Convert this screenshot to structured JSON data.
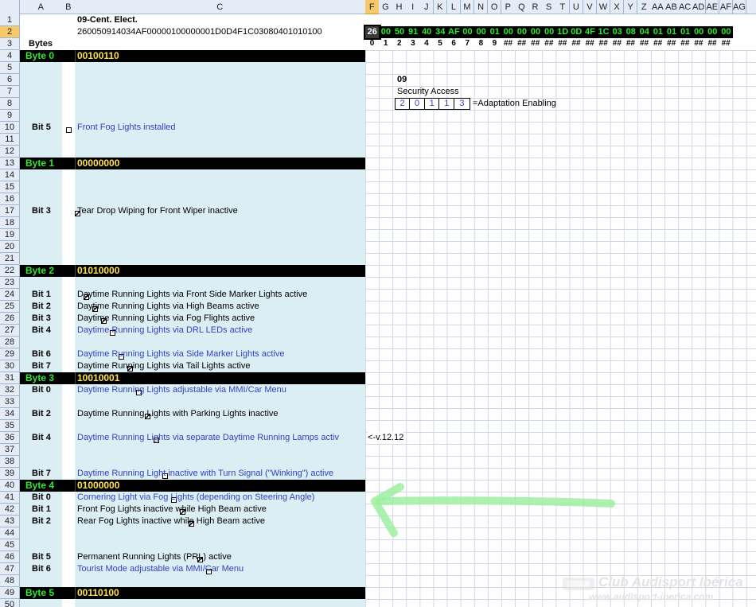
{
  "columns": [
    "A",
    "B",
    "C",
    "F",
    "G",
    "H",
    "I",
    "J",
    "K",
    "L",
    "M",
    "N",
    "O",
    "P",
    "Q",
    "R",
    "S",
    "T",
    "U",
    "V",
    "W",
    "X",
    "Y",
    "Z",
    "AA",
    "AB",
    "AC",
    "AD",
    "AE",
    "AF",
    "AG"
  ],
  "rows": [
    "1",
    "2",
    "3",
    "4",
    "5",
    "6",
    "7",
    "8",
    "9",
    "10",
    "11",
    "12",
    "13",
    "14",
    "15",
    "16",
    "17",
    "18",
    "19",
    "20",
    "21",
    "22",
    "23",
    "24",
    "25",
    "26",
    "27",
    "28",
    "29",
    "30",
    "31",
    "32",
    "33",
    "34",
    "35",
    "36",
    "37",
    "38",
    "39",
    "40",
    "41",
    "42",
    "43",
    "44",
    "45",
    "46",
    "47",
    "48",
    "49",
    "50"
  ],
  "header": {
    "module": "09-Cent. Elect.",
    "coding": "260050914034AF00000100000001D0D4F1C03080401010100",
    "bytes_label": "Bytes"
  },
  "hex_values": [
    "26",
    "00",
    "50",
    "91",
    "40",
    "34",
    "AF",
    "00",
    "00",
    "01",
    "00",
    "00",
    "00",
    "00",
    "1D",
    "0D",
    "4F",
    "1C",
    "03",
    "08",
    "04",
    "01",
    "01",
    "01",
    "00",
    "00",
    "00"
  ],
  "index_values": [
    "0",
    "1",
    "2",
    "3",
    "4",
    "5",
    "6",
    "7",
    "8",
    "9",
    "##",
    "##",
    "##",
    "##",
    "##",
    "##",
    "##",
    "##",
    "##",
    "##",
    "##",
    "##",
    "##",
    "##",
    "##",
    "##",
    "##"
  ],
  "security": {
    "module": "09",
    "title": "Security Access",
    "digits": [
      "2",
      "0",
      "1",
      "1",
      "3"
    ],
    "note": "=Adaptation Enabling"
  },
  "version_note": "<-v.12.12",
  "bytes": [
    {
      "title": "Byte 0",
      "bits": "00100110"
    },
    {
      "title": "Byte 1",
      "bits": "00000000"
    },
    {
      "title": "Byte 2",
      "bits": "01010000"
    },
    {
      "title": "Byte 3",
      "bits": "10010001"
    },
    {
      "title": "Byte 4",
      "bits": "01000000"
    },
    {
      "title": "Byte 5",
      "bits": "00110100"
    }
  ],
  "entries": [
    {
      "bit": "Bit 5",
      "text": "Front Fog Lights installed",
      "checked": false
    },
    {
      "bit": "Bit 3",
      "text": "Tear Drop Wiping for Front Wiper inactive",
      "checked": true
    },
    {
      "bit": "Bit 1",
      "text": "Daytime Running Lights via Front Side Marker Lights active",
      "checked": true
    },
    {
      "bit": "Bit 2",
      "text": "Daytime Running Lights via High Beams active",
      "checked": true
    },
    {
      "bit": "Bit 3",
      "text": "Daytime Running Lights via Fog Flights active",
      "checked": true
    },
    {
      "bit": "Bit 4",
      "text": "Daytime Running Lights via DRL LEDs active",
      "checked": false
    },
    {
      "bit": "Bit 6",
      "text": "Daytime Running Lights via Side Marker Lights active",
      "checked": false
    },
    {
      "bit": "Bit 7",
      "text": "Daytime Running Lights via Tail Lights active",
      "checked": true
    },
    {
      "bit": "Bit 0",
      "text": "Daytime Running Lights adjustable via MMI/Car Menu",
      "checked": false
    },
    {
      "bit": "Bit 2",
      "text": "Daytime Running Lights with Parking Lights inactive",
      "checked": true
    },
    {
      "bit": "Bit 4",
      "text": "Daytime Running Lights via separate Daytime Running Lamps activ",
      "checked": false
    },
    {
      "bit": "Bit 7",
      "text": "Daytime Running Light inactive with Turn Signal (\"Winking\") active",
      "checked": false
    },
    {
      "bit": "Bit 0",
      "text": "Cornering Light via Fog Lights (depending on Steering Angle)",
      "checked": false
    },
    {
      "bit": "Bit 1",
      "text": "Front Fog Lights inactive while High Beam active",
      "checked": true
    },
    {
      "bit": "Bit 2",
      "text": "Rear Fog Lights inactive while High Beam active",
      "checked": true
    },
    {
      "bit": "Bit 5",
      "text": "Permanent Running Lights (PRL) active",
      "checked": true
    },
    {
      "bit": "Bit 6",
      "text": "Tourist Mode adjustable via MMI/Car Menu",
      "checked": false
    }
  ],
  "watermark": {
    "line1": "Club Audisport Ibérica",
    "line2": "www.audisport-iberica.com"
  },
  "colors": {
    "byte_title": "#2ee82e",
    "byte_bits": "#ffe24a",
    "blue_text": "#3440c0",
    "panel": "#dbeef4",
    "arrow": "#9ef0a0"
  }
}
